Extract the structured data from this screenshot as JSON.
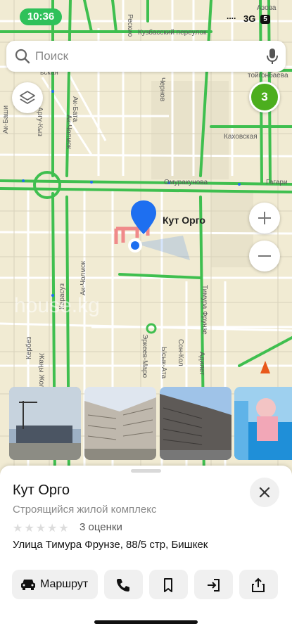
{
  "status_bar": {
    "time": "10:36",
    "signal": "....",
    "network": "3G",
    "battery": "5"
  },
  "search": {
    "placeholder": "Поиск"
  },
  "map": {
    "streets": [
      "Кузбасский переулок",
      "Каховская",
      "Омуракунова",
      "Гагари",
      "Ак-Бата",
      "Ак-Чолмок",
      "Ак-Чолмок",
      "Карасуз",
      "Кербез",
      "Жаңы Жолу",
      "Тимура Фрунзе",
      "Эркеев-Маро",
      "Сон-Кол",
      "Адилет",
      "Ысык-Ата",
      "Чернов",
      "Аргу-Кыз",
      "тойгонбаева",
      "Ак-Баши",
      "ьская",
      "Азова",
      "Рескио"
    ],
    "cluster_count": "3",
    "marker_label": "Кут Орго",
    "watermark": "house.kg",
    "zoom_in": "+",
    "zoom_out": "−"
  },
  "photos": [
    {
      "alt": "photo-1"
    },
    {
      "alt": "photo-2"
    },
    {
      "alt": "photo-3"
    },
    {
      "alt": "photo-4"
    }
  ],
  "place": {
    "title": "Кут Орго",
    "subtitle": "Строящийся жилой комплекс",
    "stars": "★★★★★",
    "rating_text": "3 оценки",
    "address": "Улица Тимура Фрунзе, 88/5 стр, Бишкек"
  },
  "actions": {
    "route_label": "Маршрут"
  },
  "colors": {
    "road_green": "#3fbf4f",
    "marker_blue": "#1e6ff0",
    "cluster_green": "#4cae1e",
    "status_green": "#2fc15a"
  }
}
